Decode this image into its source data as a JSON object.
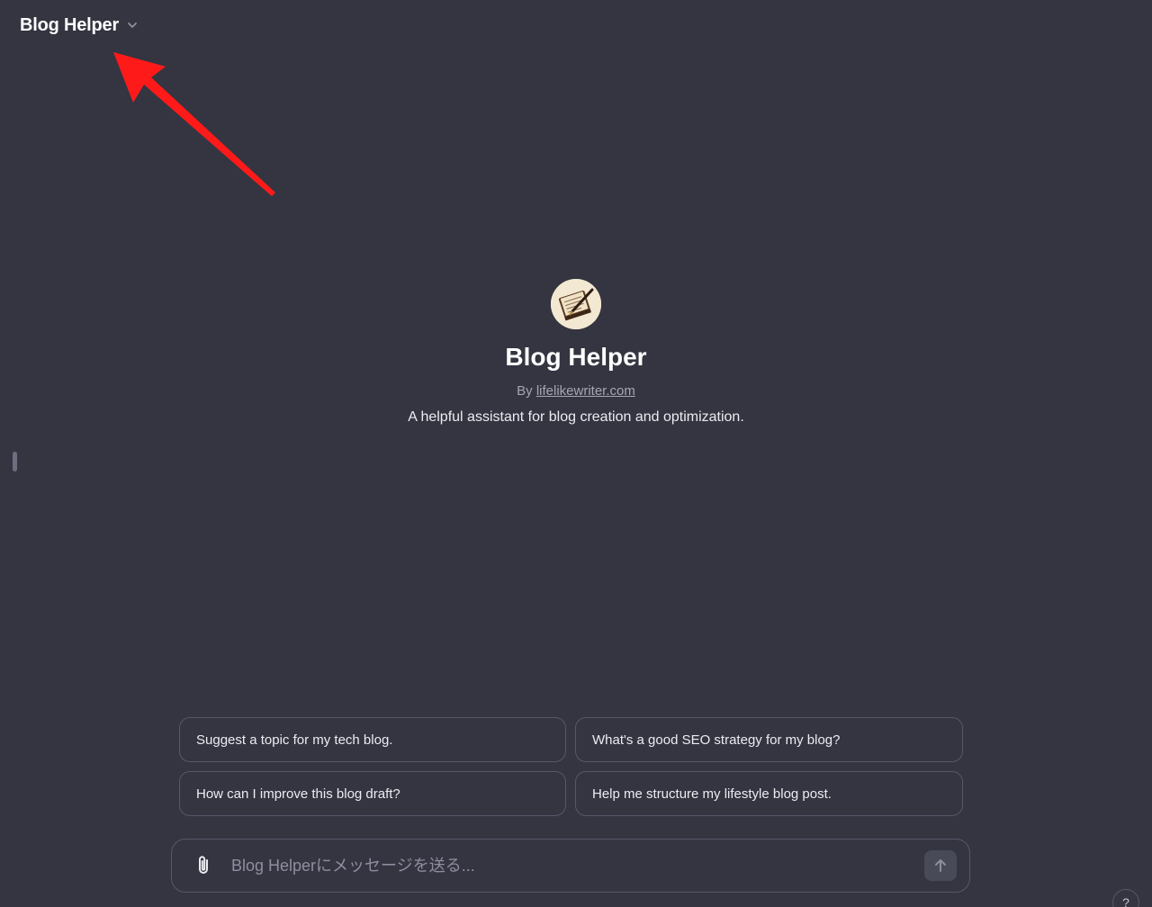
{
  "header": {
    "model_title": "Blog Helper",
    "dropdown_icon": "chevron-down-icon"
  },
  "annotation": {
    "arrow_color": "#ff1a1a"
  },
  "gpt": {
    "avatar_icon": "notebook-pen-icon",
    "name": "Blog Helper",
    "by_prefix": "By",
    "author_link": "lifelikewriter.com",
    "description": "A helpful assistant for blog creation and optimization."
  },
  "suggestions": [
    "Suggest a topic for my tech blog.",
    "What's a good SEO strategy for my blog?",
    "How can I improve this blog draft?",
    "Help me structure my lifestyle blog post."
  ],
  "composer": {
    "placeholder": "Blog Helperにメッセージを送る...",
    "attach_icon": "paperclip-icon",
    "send_icon": "arrow-up-icon"
  },
  "help": {
    "label": "?"
  },
  "colors": {
    "background": "#343541",
    "border": "#565869",
    "text": "#ececf1",
    "muted": "#a6a6b3"
  }
}
